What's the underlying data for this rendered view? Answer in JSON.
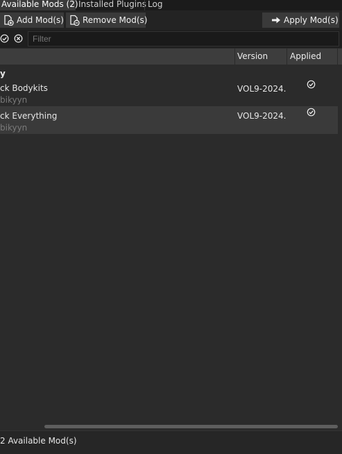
{
  "tabs": [
    {
      "label": "Available Mods (2)",
      "active": true
    },
    {
      "label": "Installed Plugins",
      "active": false
    },
    {
      "label": "Log",
      "active": false
    }
  ],
  "toolbar": {
    "add_label": "Add Mod(s)",
    "remove_label": "Remove Mod(s)",
    "apply_label": "Apply Mod(s)"
  },
  "filter": {
    "placeholder": "Filter",
    "value": ""
  },
  "columns": {
    "version": "Version",
    "applied": "Applied"
  },
  "group_label": "y",
  "mods": [
    {
      "name": "ck Bodykits",
      "author": "bikyyn",
      "version": "VOL9-2024.",
      "applied": true,
      "icon": "check-circle-icon"
    },
    {
      "name": "ck Everything",
      "author": "bikyyn",
      "version": "VOL9-2024.",
      "applied": true,
      "icon": "check-circle-icon"
    }
  ],
  "status": {
    "text": "2 Available Mod(s)"
  },
  "colors": {
    "background": "#2b2b2b",
    "header": "#3d3d3d",
    "selected_row": "#3a3a3a",
    "text": "#e6e6e6"
  }
}
